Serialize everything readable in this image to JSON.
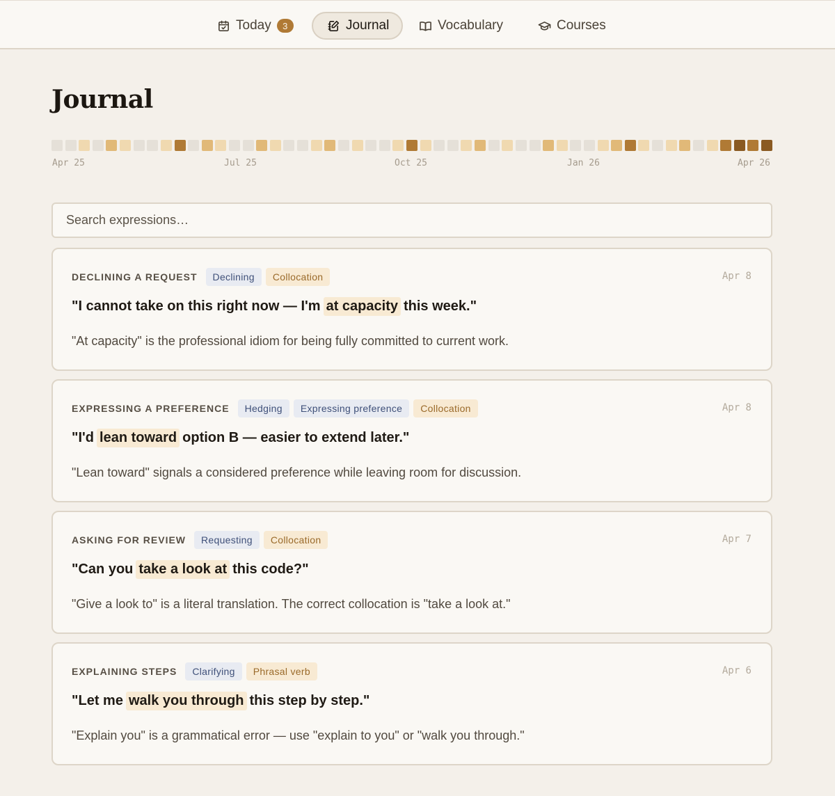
{
  "nav": {
    "items": [
      {
        "label": "Today",
        "icon": "calendar-check-icon",
        "badge": "3"
      },
      {
        "label": "Journal",
        "icon": "journal-edit-icon",
        "active": true
      },
      {
        "label": "Vocabulary",
        "icon": "open-book-icon"
      },
      {
        "label": "Courses",
        "icon": "graduation-cap-icon"
      }
    ]
  },
  "page": {
    "title": "Journal"
  },
  "activity": {
    "months": [
      "Apr 25",
      "Jul 25",
      "Oct 25",
      "Jan 26",
      "Apr 26"
    ],
    "levels": [
      0,
      0,
      1,
      0,
      2,
      1,
      0,
      0,
      1,
      3,
      0,
      2,
      1,
      0,
      0,
      2,
      1,
      0,
      0,
      1,
      2,
      0,
      1,
      0,
      0,
      1,
      3,
      1,
      0,
      0,
      1,
      2,
      0,
      1,
      0,
      0,
      2,
      1,
      0,
      0,
      1,
      2,
      3,
      1,
      0,
      1,
      2,
      0,
      1,
      3,
      4,
      3,
      4
    ],
    "colors": [
      "#e5e0d8",
      "#f0d9b0",
      "#e1b978",
      "#b07a35",
      "#8a5a22"
    ]
  },
  "search": {
    "placeholder": "Search expressions…",
    "value": ""
  },
  "entries": [
    {
      "category": "Declining a request",
      "tags": [
        {
          "label": "Declining",
          "kind": "blue"
        },
        {
          "label": "Collocation",
          "kind": "tan"
        }
      ],
      "date": "Apr 8",
      "quote_before": "\"I cannot take on this right now — I'm",
      "quote_highlight": "at capacity",
      "quote_after": "this week.\"",
      "note": "\"At capacity\" is the professional idiom for being fully committed to current work."
    },
    {
      "category": "Expressing a preference",
      "tags": [
        {
          "label": "Hedging",
          "kind": "blue"
        },
        {
          "label": "Expressing preference",
          "kind": "blue"
        },
        {
          "label": "Collocation",
          "kind": "tan"
        }
      ],
      "date": "Apr 8",
      "quote_before": "\"I'd",
      "quote_highlight": "lean toward",
      "quote_after": "option B — easier to extend later.\"",
      "note": "\"Lean toward\" signals a considered preference while leaving room for discussion."
    },
    {
      "category": "Asking for review",
      "tags": [
        {
          "label": "Requesting",
          "kind": "blue"
        },
        {
          "label": "Collocation",
          "kind": "tan"
        }
      ],
      "date": "Apr 7",
      "quote_before": "\"Can you",
      "quote_highlight": "take a look at",
      "quote_after": "this code?\"",
      "note": "\"Give a look to\" is a literal translation. The correct collocation is \"take a look at.\""
    },
    {
      "category": "Explaining steps",
      "tags": [
        {
          "label": "Clarifying",
          "kind": "blue"
        },
        {
          "label": "Phrasal verb",
          "kind": "tan"
        }
      ],
      "date": "Apr 6",
      "quote_before": "\"Let me",
      "quote_highlight": "walk you through",
      "quote_after": "this step by step.\"",
      "note": "\"Explain you\" is a grammatical error — use \"explain to you\" or \"walk you through.\""
    }
  ]
}
